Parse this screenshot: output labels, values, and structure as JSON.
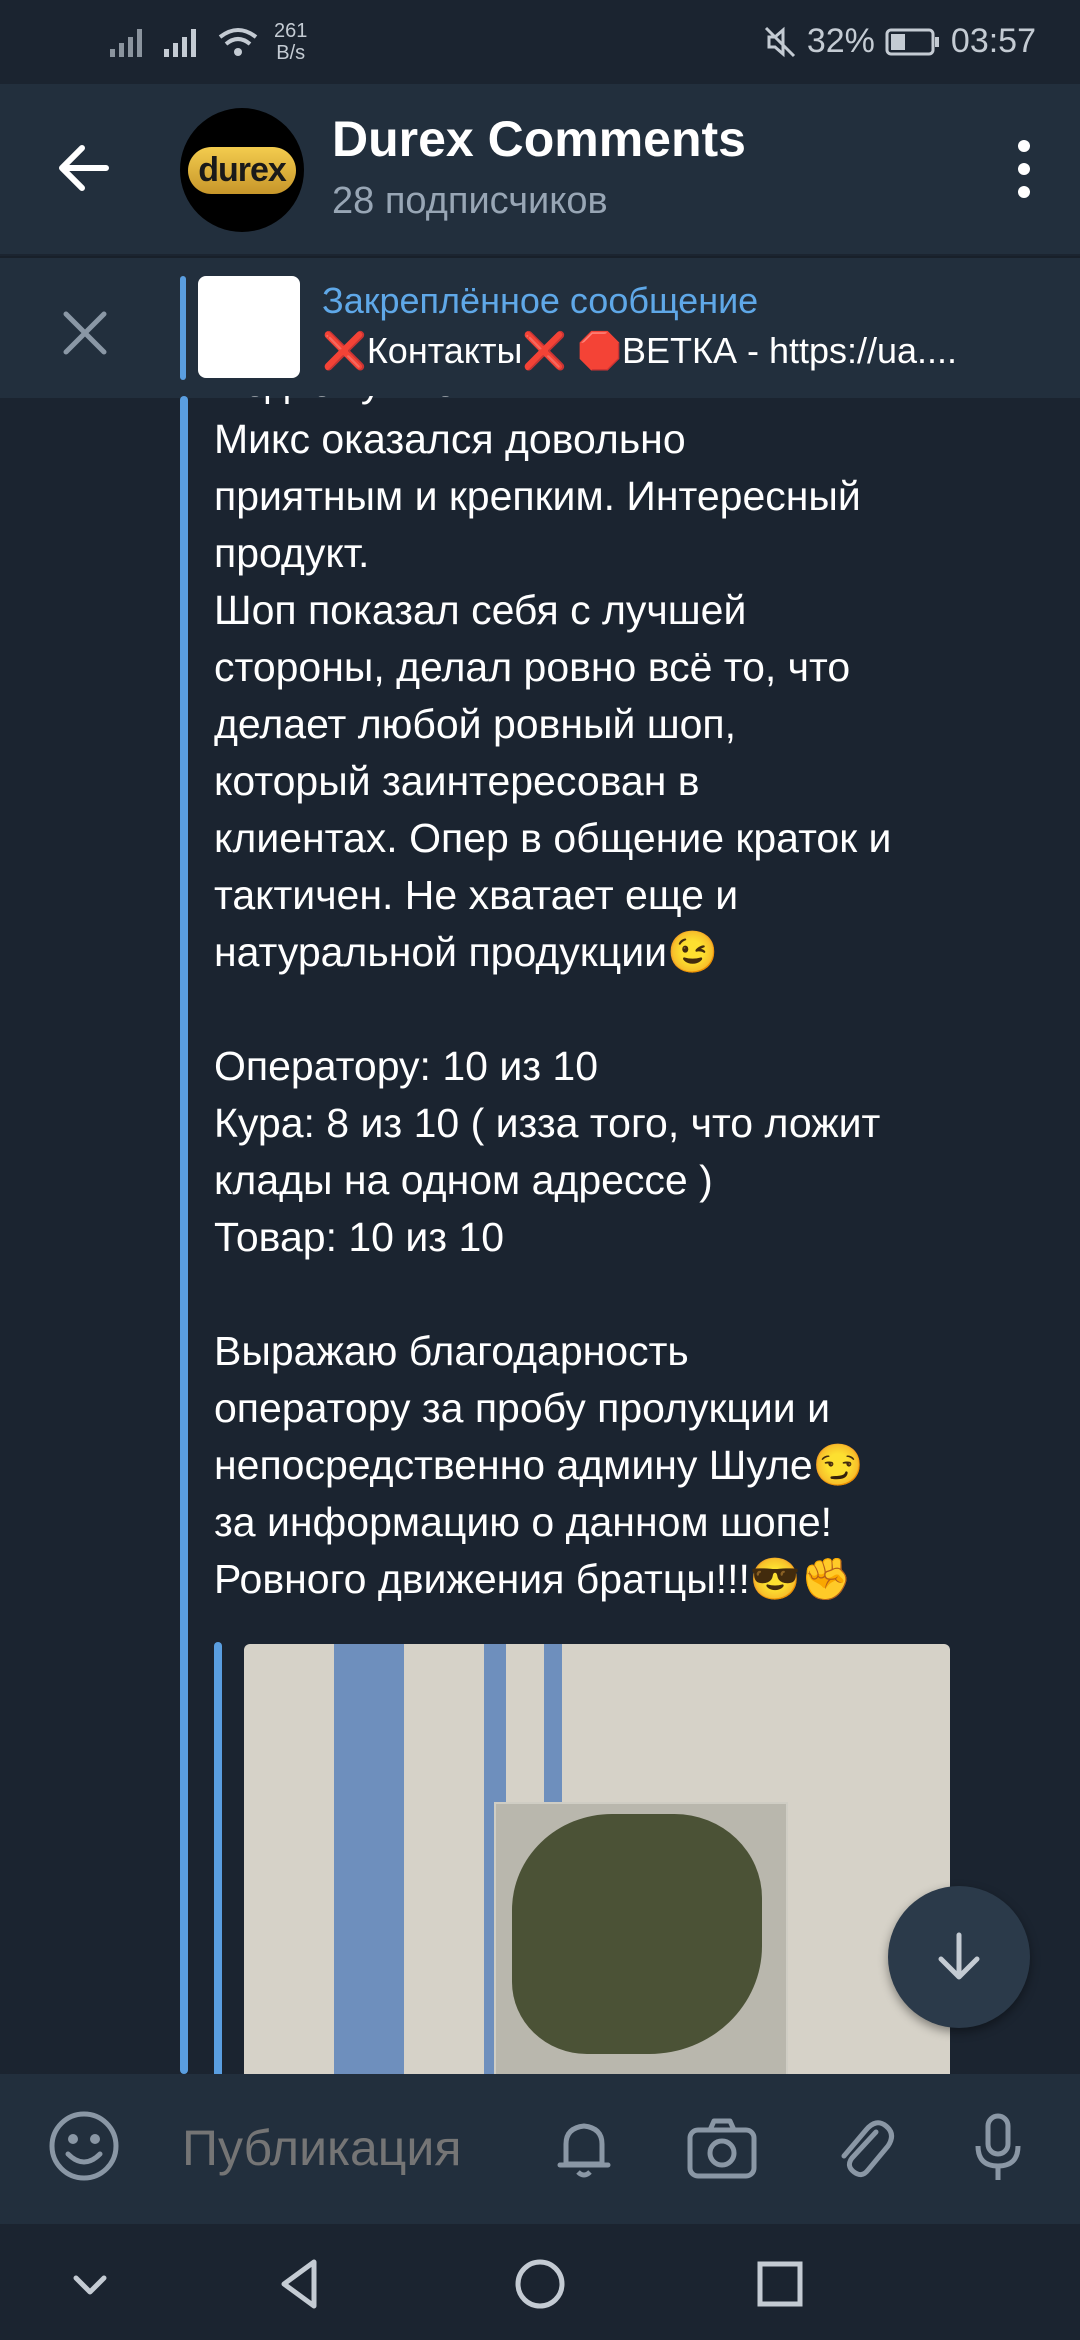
{
  "status_bar": {
    "net_speed_value": "261",
    "net_speed_unit": "B/s",
    "battery": "32%",
    "time": "03:57"
  },
  "header": {
    "title": "Durex Comments",
    "subtitle": "28 подписчиков",
    "avatar_text": "durex"
  },
  "pinned": {
    "title": "Закреплённое сообщение",
    "text": "❌Контакты❌ 🛑ВЕТКА - https://ua...."
  },
  "message": {
    "text": "Подвожу итоги.\nМикс оказался довольно\nприятным и крепким. Интересный\nпродукт.\nШоп показал себя с лучшей\nстороны, делал ровно всё то, что\nделает любой ровный шоп,\nкоторый заинтересован в\nклиентах. Опер в общение краток и\nтактичен. Не хватает еще и\nнатуральной продукции😉\n\nОператору: 10 из 10\nКура: 8 из 10 ( изза того, что ложит\nклады на одном адрессе )\nТовар: 10 из 10\n\nВыражаю благодарность\nоператору за пробу пролукции и\nнепосредственно админу Шуле😏\nза информацию о данном шопе!\nРовного движения братцы!!!😎✊"
  },
  "input": {
    "placeholder": "Публикация"
  },
  "colors": {
    "background": "#1b2430",
    "header": "#222f3d",
    "accent": "#5a9ee0",
    "pinned_title": "#5fa8e8",
    "muted": "#98a6b5"
  }
}
